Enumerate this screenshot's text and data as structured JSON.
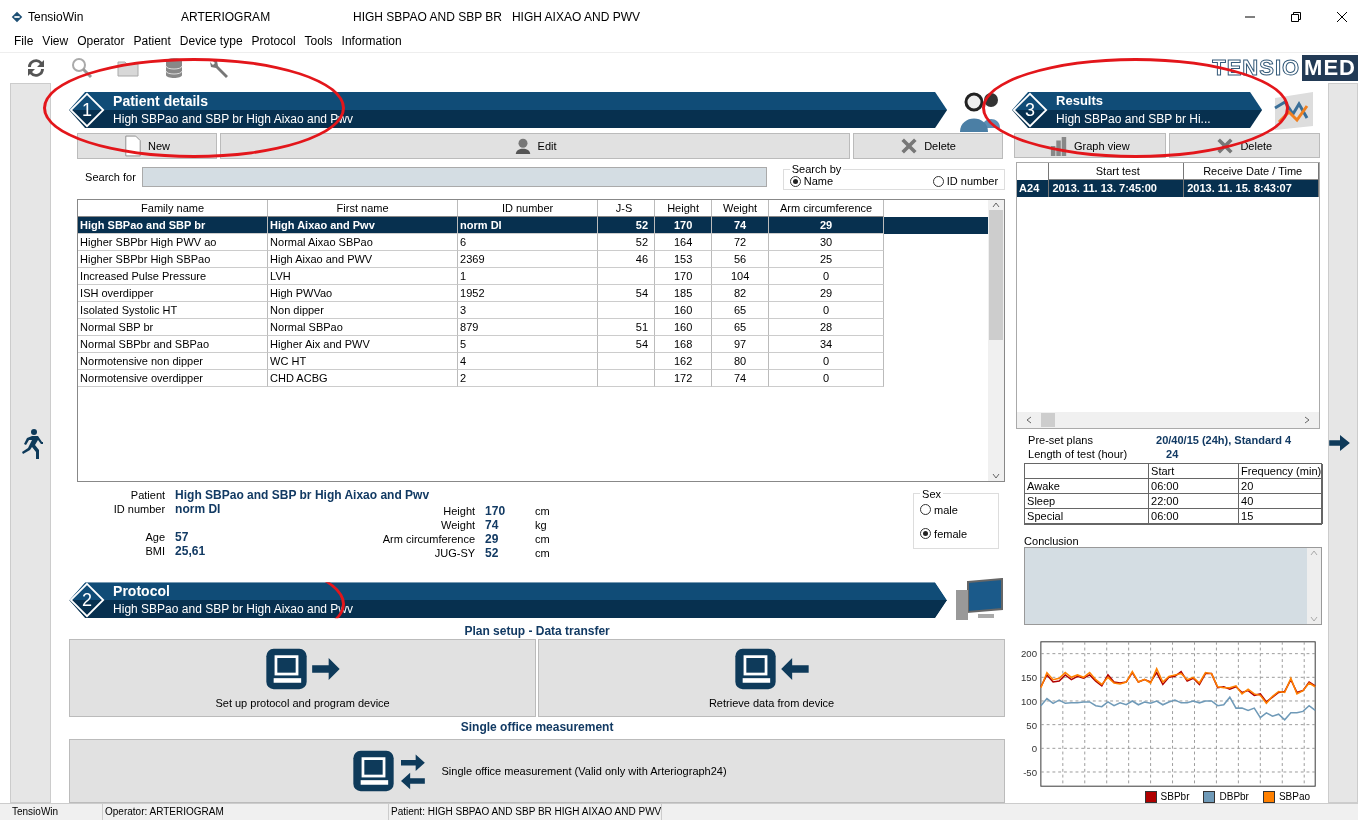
{
  "window": {
    "app": "TensioWin",
    "operator": "ARTERIOGRAM",
    "patient": "HIGH SBPAO AND SBP BR   HIGH AIXAO AND PWV"
  },
  "menu": [
    "File",
    "View",
    "Operator",
    "Patient",
    "Device type",
    "Protocol",
    "Tools",
    "Information"
  ],
  "toolbar": [
    {
      "kind": "refresh"
    },
    {
      "kind": "search"
    },
    {
      "kind": "folder"
    },
    {
      "kind": "database"
    },
    {
      "kind": "wrench"
    }
  ],
  "brand": {
    "part1": "TENSIO",
    "part2": "MED"
  },
  "patient_section": {
    "number": "1",
    "title": "Patient details",
    "subtitle": "High SBPao and SBP br High Aixao and Pwv",
    "circled": true
  },
  "patient_buttons": [
    {
      "label": "New",
      "kind": "document"
    },
    {
      "label": "Edit",
      "kind": "person"
    },
    {
      "label": "Delete",
      "kind": "cross"
    }
  ],
  "search": {
    "label": "Search for",
    "by_label": "Search by",
    "options": [
      {
        "label": "Name",
        "selected": true
      },
      {
        "label": "ID number",
        "selected": false
      }
    ]
  },
  "table": {
    "columns": [
      "Family name",
      "First name",
      "ID number",
      "J-S",
      "Height",
      "Weight",
      "Arm circumference"
    ],
    "rows": [
      {
        "cells": [
          "High SBPao and SBP br",
          "High Aixao and Pwv",
          "norm DI",
          "52",
          "170",
          "74",
          "29"
        ],
        "selected": true
      },
      {
        "cells": [
          "Higher SBPbr High PWV ao",
          "Normal Aixao SBPao",
          "6",
          "52",
          "164",
          "72",
          "30"
        ],
        "selected": false
      },
      {
        "cells": [
          "Higher SBPbr High SBPao",
          "High Aixao and PWV",
          "2369",
          "46",
          "153",
          "56",
          "25"
        ],
        "selected": false
      },
      {
        "cells": [
          "Increased Pulse Pressure",
          "LVH",
          "1",
          "",
          "170",
          "104",
          "0"
        ],
        "selected": false
      },
      {
        "cells": [
          "ISH overdipper",
          "High PWVao",
          "1952",
          "54",
          "185",
          "82",
          "29"
        ],
        "selected": false
      },
      {
        "cells": [
          "Isolated Systolic HT",
          "Non dipper",
          "3",
          "",
          "160",
          "65",
          "0"
        ],
        "selected": false
      },
      {
        "cells": [
          "Normal SBP br",
          "Normal SBPao",
          "879",
          "51",
          "160",
          "65",
          "28"
        ],
        "selected": false
      },
      {
        "cells": [
          "Normal SBPbr and SBPao",
          "Higher Aix and PWV",
          "5",
          "54",
          "168",
          "97",
          "34"
        ],
        "selected": false
      },
      {
        "cells": [
          "Normotensive non dipper",
          "WC HT",
          "4",
          "",
          "162",
          "80",
          "0"
        ],
        "selected": false
      },
      {
        "cells": [
          "Normotensive overdipper",
          "CHD ACBG",
          "2",
          "",
          "172",
          "74",
          "0"
        ],
        "selected": false
      }
    ]
  },
  "details": {
    "left": [
      {
        "label": "Patient",
        "value": "High SBPao and SBP br High Aixao and Pwv"
      },
      {
        "label": "ID number",
        "value": "norm DI"
      },
      {
        "label": "Age",
        "value": "57"
      },
      {
        "label": "BMI",
        "value": "25,61"
      }
    ],
    "right": [
      {
        "label": "Height",
        "value": "170",
        "unit": "cm"
      },
      {
        "label": "Weight",
        "value": "74",
        "unit": "kg"
      },
      {
        "label": "Arm circumference",
        "value": "29",
        "unit": "cm"
      },
      {
        "label": "JUG-SY",
        "value": "52",
        "unit": "cm"
      }
    ],
    "sex": {
      "label": "Sex",
      "options": [
        {
          "label": "male",
          "selected": false
        },
        {
          "label": "female",
          "selected": true
        }
      ]
    }
  },
  "protocol_section": {
    "number": "2",
    "title": "Protocol",
    "subtitle": "High SBPao and SBP br High Aixao and Pwv",
    "circled": true
  },
  "plan_title": "Plan setup - Data transfer",
  "transfer_buttons": [
    {
      "label": "Set up protocol and program device",
      "kind": "out"
    },
    {
      "label": "Retrieve data from device",
      "kind": "in"
    }
  ],
  "single_title": "Single office measurement",
  "single_button": {
    "label": "Single office measurement (Valid only with Arteriograph24)",
    "kind": "both"
  },
  "results_section": {
    "number": "3",
    "title": "Results",
    "subtitle": "High SBPao and SBP br Hi...",
    "circled": true
  },
  "results_buttons": [
    {
      "label": "Graph view",
      "kind": "bars"
    },
    {
      "label": "Delete",
      "kind": "cross"
    }
  ],
  "results_table": {
    "columns": [
      "Start test",
      "Receive Date / Time"
    ],
    "rows": [
      {
        "type": "A24",
        "cells": [
          "2013. 11. 13. 7:45:00",
          "2013. 11. 15. 8:43:07"
        ],
        "selected": true
      }
    ]
  },
  "plan": {
    "preset_label": "Pre-set plans",
    "preset_value": "20/40/15 (24h), Standard 4",
    "length_label": "Length of test (hour)",
    "length_value": "24",
    "columns": [
      "Start",
      "Frequency (min)"
    ],
    "rows": [
      {
        "name": "Awake",
        "start": "06:00",
        "frequency": "20"
      },
      {
        "name": "Sleep",
        "start": "22:00",
        "frequency": "40"
      },
      {
        "name": "Special",
        "start": "06:00",
        "frequency": "15"
      }
    ]
  },
  "conclusion_label": "Conclusion",
  "chart": {
    "chart_data": {
      "type": "line",
      "ylim": [
        -80,
        225
      ],
      "yticks": [
        -50,
        0,
        50,
        100,
        150,
        200
      ],
      "grid": true,
      "legend": "bottom",
      "series": [
        {
          "name": "SBPbr",
          "color": "#b00000",
          "values": [
            130,
            155,
            140,
            142,
            155,
            145,
            152,
            148,
            155,
            142,
            132,
            155,
            140,
            138,
            140,
            160,
            140,
            145,
            140,
            160,
            135,
            150,
            152,
            162,
            142,
            148,
            135,
            158,
            158,
            128,
            130,
            125,
            130,
            118,
            122,
            112,
            115,
            98,
            108,
            118,
            120,
            145,
            118,
            122,
            140,
            132
          ]
        },
        {
          "name": "DBPbr",
          "color": "#6f9ab8",
          "values": [
            90,
            105,
            95,
            102,
            95,
            96,
            96,
            98,
            98,
            90,
            88,
            98,
            90,
            96,
            92,
            100,
            92,
            98,
            95,
            100,
            92,
            98,
            102,
            96,
            96,
            100,
            96,
            100,
            100,
            90,
            92,
            108,
            85,
            85,
            80,
            85,
            65,
            75,
            68,
            72,
            60,
            75,
            75,
            78,
            90,
            80
          ]
        },
        {
          "name": "SBPao",
          "color": "#ff8000",
          "values": [
            128,
            160,
            145,
            148,
            160,
            150,
            155,
            150,
            160,
            145,
            135,
            150,
            138,
            136,
            140,
            162,
            140,
            146,
            138,
            168,
            140,
            152,
            155,
            158,
            145,
            150,
            138,
            160,
            158,
            130,
            128,
            128,
            132,
            115,
            125,
            115,
            112,
            95,
            110,
            120,
            118,
            148,
            115,
            122,
            138,
            130
          ]
        }
      ]
    }
  },
  "status_bar": [
    "TensioWin",
    "Operator: ARTERIOGRAM",
    "Patient: HIGH SBPAO AND SBP BR   HIGH AIXAO AND PWV"
  ]
}
